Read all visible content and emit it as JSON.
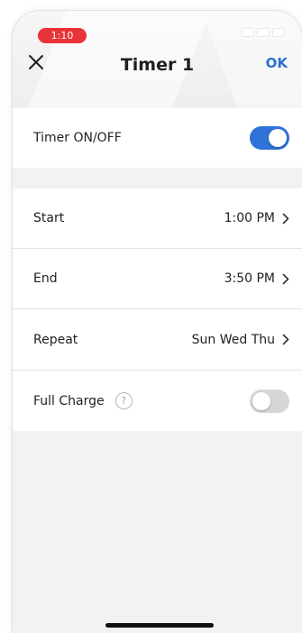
{
  "status_bar": {
    "time": "1:10"
  },
  "header": {
    "title": "Timer 1",
    "ok_label": "OK"
  },
  "timer_toggle": {
    "label": "Timer ON/OFF",
    "state": "on"
  },
  "schedule": {
    "start": {
      "label": "Start",
      "value": "1:00 PM"
    },
    "end": {
      "label": "End",
      "value": "3:50 PM"
    },
    "repeat": {
      "label": "Repeat",
      "value": "Sun Wed Thu"
    }
  },
  "full_charge": {
    "label": "Full Charge",
    "help_symbol": "?",
    "state": "off"
  },
  "colors": {
    "accent": "#2f72d8",
    "status_badge": "#e8333a",
    "toggle_off": "#d6d6d6",
    "background": "#f2f2f2"
  },
  "icons": {
    "close": "close-icon",
    "chevron": "chevron-right-icon",
    "help": "help-icon"
  }
}
